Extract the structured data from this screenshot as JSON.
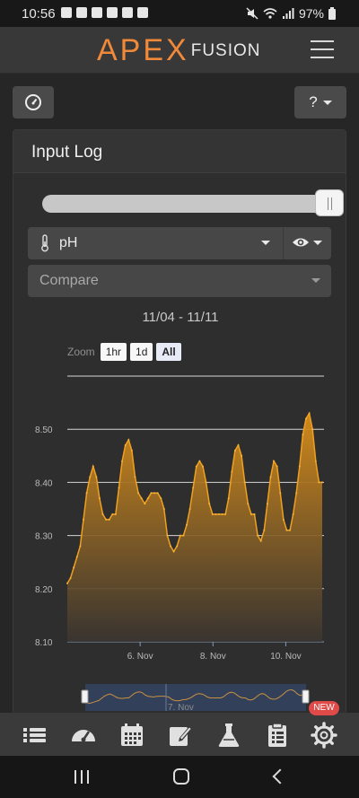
{
  "status_bar": {
    "time": "10:56",
    "battery": "97%",
    "icons": [
      "chat-icon",
      "signal-x-icon",
      "app-icon",
      "bird-icon",
      "image-icon",
      "wrench-icon",
      "mute-icon",
      "wifi-icon",
      "cell-signal-icon",
      "battery-icon"
    ]
  },
  "header": {
    "logo_main": "APEX",
    "logo_sub": "FUSION",
    "menu_icon": "hamburger-icon"
  },
  "toolbar": {
    "dashboard_icon": "gauge-icon",
    "help_label": "?",
    "help_icon": "question-icon"
  },
  "panel": {
    "title": "Input Log",
    "time_slider_position": 1.0,
    "input_select": {
      "icon": "thermometer-icon",
      "value": "pH",
      "view_icon": "eye-icon"
    },
    "compare_select": {
      "placeholder": "Compare"
    },
    "date_range": "11/04 - 11/11",
    "zoom": {
      "label": "Zoom",
      "buttons": [
        "1hr",
        "1d",
        "All"
      ],
      "selected": "All"
    }
  },
  "chart_data": {
    "type": "area",
    "series": [
      {
        "values": [
          8.21,
          8.22,
          8.24,
          8.26,
          8.28,
          8.33,
          8.38,
          8.41,
          8.43,
          8.41,
          8.37,
          8.34,
          8.33,
          8.33,
          8.34,
          8.34,
          8.39,
          8.44,
          8.47,
          8.48,
          8.46,
          8.41,
          8.38,
          8.37,
          8.36,
          8.37,
          8.38,
          8.38,
          8.38,
          8.37,
          8.35,
          8.3,
          8.28,
          8.27,
          8.28,
          8.3,
          8.3,
          8.32,
          8.35,
          8.39,
          8.43,
          8.44,
          8.43,
          8.4,
          8.36,
          8.34,
          8.34,
          8.34,
          8.34,
          8.34,
          8.37,
          8.42,
          8.46,
          8.47,
          8.45,
          8.4,
          8.36,
          8.34,
          8.34,
          8.3,
          8.29,
          8.31,
          8.36,
          8.41,
          8.44,
          8.43,
          8.38,
          8.33,
          8.31,
          8.31,
          8.34,
          8.38,
          8.43,
          8.49,
          8.52,
          8.53,
          8.5,
          8.44,
          8.4,
          8.4
        ]
      }
    ],
    "x_start": "11/04",
    "x_end": "11/11",
    "xticks": [
      "6. Nov",
      "8. Nov",
      "10. Nov"
    ],
    "yticks": [
      "8.10",
      "8.20",
      "8.30",
      "8.40",
      "8.50"
    ],
    "ylim": [
      8.1,
      8.6
    ],
    "grid": true,
    "colors": {
      "line": "#f0a020",
      "fill_top": "#d98e1a",
      "fill_bottom": "#3a3530"
    }
  },
  "navigator": {
    "label": "7. Nov"
  },
  "bottom_nav": {
    "items": [
      {
        "icon": "list-icon"
      },
      {
        "icon": "dashboard-gauge-icon"
      },
      {
        "icon": "calendar-icon"
      },
      {
        "icon": "edit-note-icon"
      },
      {
        "icon": "flask-icon"
      },
      {
        "icon": "clipboard-icon"
      },
      {
        "icon": "settings-gear-icon",
        "badge": "NEW"
      }
    ]
  },
  "system_nav": {
    "buttons": [
      "recents-icon",
      "home-icon",
      "back-icon"
    ]
  }
}
